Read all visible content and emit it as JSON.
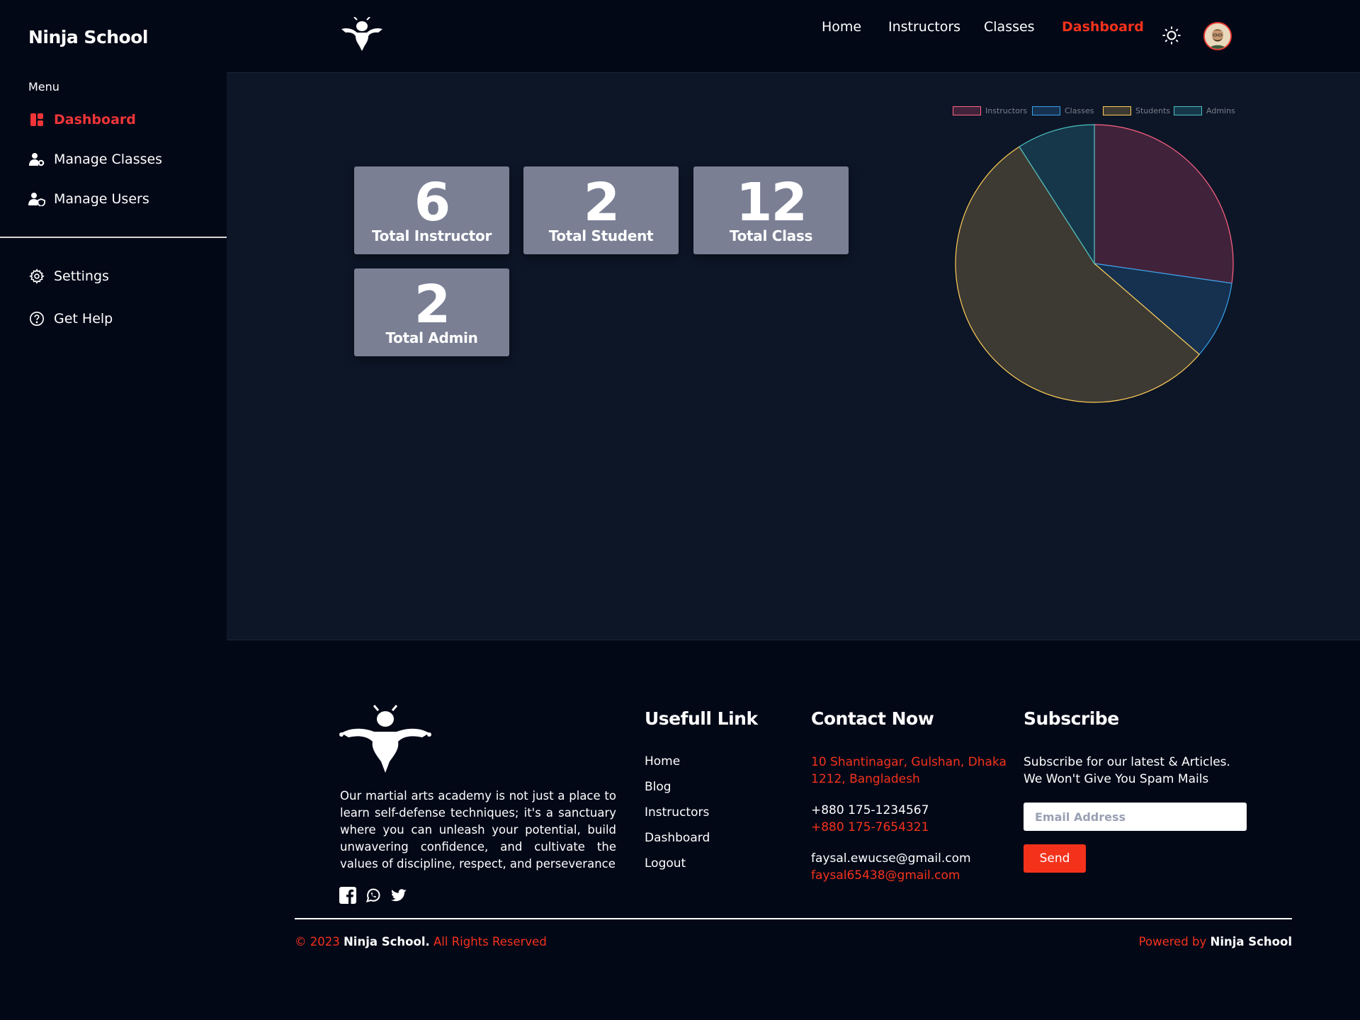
{
  "brand": "Ninja School",
  "sidebar": {
    "menu_label": "Menu",
    "items": [
      {
        "label": "Dashboard",
        "icon": "dashboard-icon",
        "active": true
      },
      {
        "label": "Manage Classes",
        "icon": "user-gear-icon"
      },
      {
        "label": "Manage Users",
        "icon": "user-shield-icon"
      }
    ],
    "bottom_items": [
      {
        "label": "Settings",
        "icon": "gear-icon"
      },
      {
        "label": "Get Help",
        "icon": "help-circle-icon"
      }
    ]
  },
  "nav": {
    "items": [
      "Home",
      "Instructors",
      "Classes",
      "Dashboard"
    ],
    "active": "Dashboard",
    "theme_icon": "sun-icon",
    "avatar_icon": "avatar"
  },
  "stats": [
    {
      "value": "6",
      "label": "Total Instructor"
    },
    {
      "value": "2",
      "label": "Total Student"
    },
    {
      "value": "12",
      "label": "Total Class"
    },
    {
      "value": "2",
      "label": "Total Admin"
    }
  ],
  "chart_data": {
    "type": "pie",
    "legend_position": "top",
    "categories": [
      "Instructors",
      "Classes",
      "Students",
      "Admins"
    ],
    "values": [
      6,
      2,
      12,
      2
    ],
    "colors": {
      "Instructors": {
        "fill": "#40233a",
        "stroke": "#ff6384"
      },
      "Classes": {
        "fill": "#16304f",
        "stroke": "#36a2eb"
      },
      "Students": {
        "fill": "#3d3a33",
        "stroke": "#ffcd56"
      },
      "Admins": {
        "fill": "#16374a",
        "stroke": "#4bc0c0"
      }
    }
  },
  "footer": {
    "about": "Our martial arts academy is not just a place to learn self-defense techniques; it's a sanctuary where you can unleash your potential, build unwavering confidence, and cultivate the values of discipline, respect, and perseverance",
    "social_icons": [
      "facebook-icon",
      "whatsapp-icon",
      "twitter-icon"
    ],
    "links_title": "Usefull Link",
    "links": [
      "Home",
      "Blog",
      "Instructors",
      "Dashboard",
      "Logout"
    ],
    "contact_title": "Contact Now",
    "address": "10 Shantinagar, Gulshan, Dhaka 1212, Bangladesh",
    "phone_primary": "+880 175-1234567",
    "phone_secondary": "+880 175-7654321",
    "email_primary": "faysal.ewucse@gmail.com",
    "email_secondary": "faysal65438@gmail.com",
    "subscribe_title": "Subscribe",
    "subscribe_text": "Subscribe for our latest & Articles. We Won't Give You Spam Mails",
    "email_placeholder": "Email Address",
    "send_label": "Send",
    "copyright_prefix": "© 2023",
    "copyright_brand": "Ninja School.",
    "copyright_suffix": "All Rights Reserved",
    "powered_prefix": "Powered by",
    "powered_brand": "Ninja School"
  },
  "colors": {
    "accent": "#f4321c",
    "sidebar_active": "#ef3538",
    "background": "#030817",
    "panel": "#0d1627",
    "card": "#7a7f94"
  }
}
